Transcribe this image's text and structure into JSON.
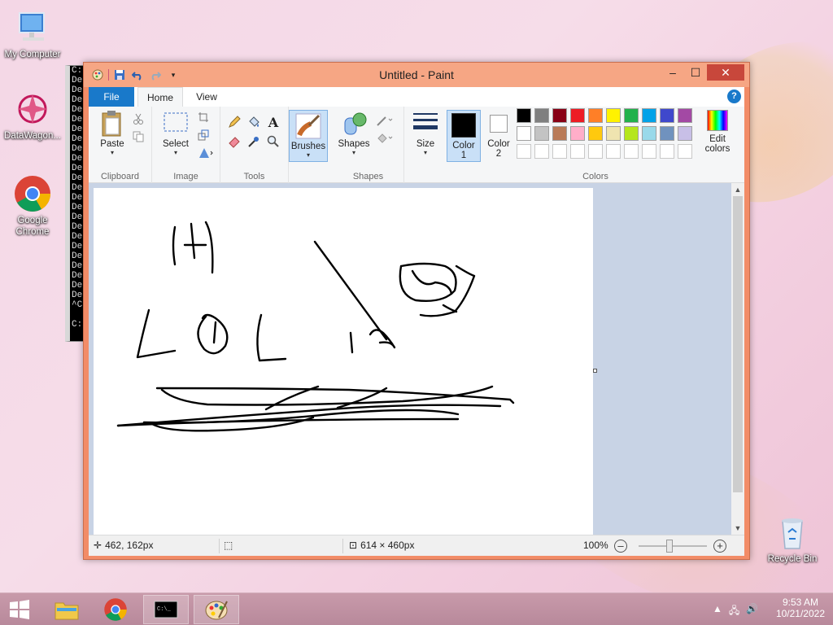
{
  "desktop": {
    "icons": [
      {
        "label": "My Computer"
      },
      {
        "label": "DataWagon..."
      },
      {
        "label": "Google Chrome"
      },
      {
        "label": "Recycle Bin"
      }
    ]
  },
  "console": {
    "lines": [
      "C:\\",
      "De",
      "De",
      "De",
      "De",
      "De",
      "De",
      "De",
      "De",
      "De",
      "De",
      "De",
      "De",
      "De",
      "De",
      "De",
      "De",
      "De",
      "De",
      "De",
      "De",
      "De",
      "De",
      "De",
      "^C",
      "",
      "C:"
    ]
  },
  "window": {
    "title": "Untitled - Paint",
    "controls": {
      "minimize": "–",
      "maximize": "☐",
      "close": "✕"
    }
  },
  "tabs": {
    "file": "File",
    "home": "Home",
    "view": "View",
    "help": "?"
  },
  "ribbon": {
    "clipboard": {
      "label": "Clipboard",
      "paste": "Paste"
    },
    "image": {
      "label": "Image",
      "select": "Select"
    },
    "tools": {
      "label": "Tools",
      "text_glyph": "A"
    },
    "brushes": {
      "label": "Brushes"
    },
    "shapes": {
      "label": "Shapes",
      "button": "Shapes"
    },
    "size": {
      "label": "Size"
    },
    "colors": {
      "label": "Colors",
      "color1": "Color",
      "color1_num": "1",
      "color2": "Color",
      "color2_num": "2",
      "edit": "Edit",
      "edit2": "colors",
      "row1": [
        "#000000",
        "#7f7f7f",
        "#880015",
        "#ed1c24",
        "#ff7f27",
        "#fff200",
        "#22b14c",
        "#00a2e8",
        "#3f48cc",
        "#a349a4"
      ],
      "row2": [
        "#ffffff",
        "#c3c3c3",
        "#b97a57",
        "#ffaec9",
        "#ffc90e",
        "#efe4b0",
        "#b5e61d",
        "#99d9ea",
        "#7092be",
        "#c8bfe7"
      ],
      "primary": "#000000",
      "secondary": "#ffffff"
    }
  },
  "status": {
    "position": "462, 162px",
    "size": "614 × 460px",
    "zoom": "100%"
  },
  "taskbar": {
    "time": "9:53 AM",
    "date": "10/21/2022"
  }
}
